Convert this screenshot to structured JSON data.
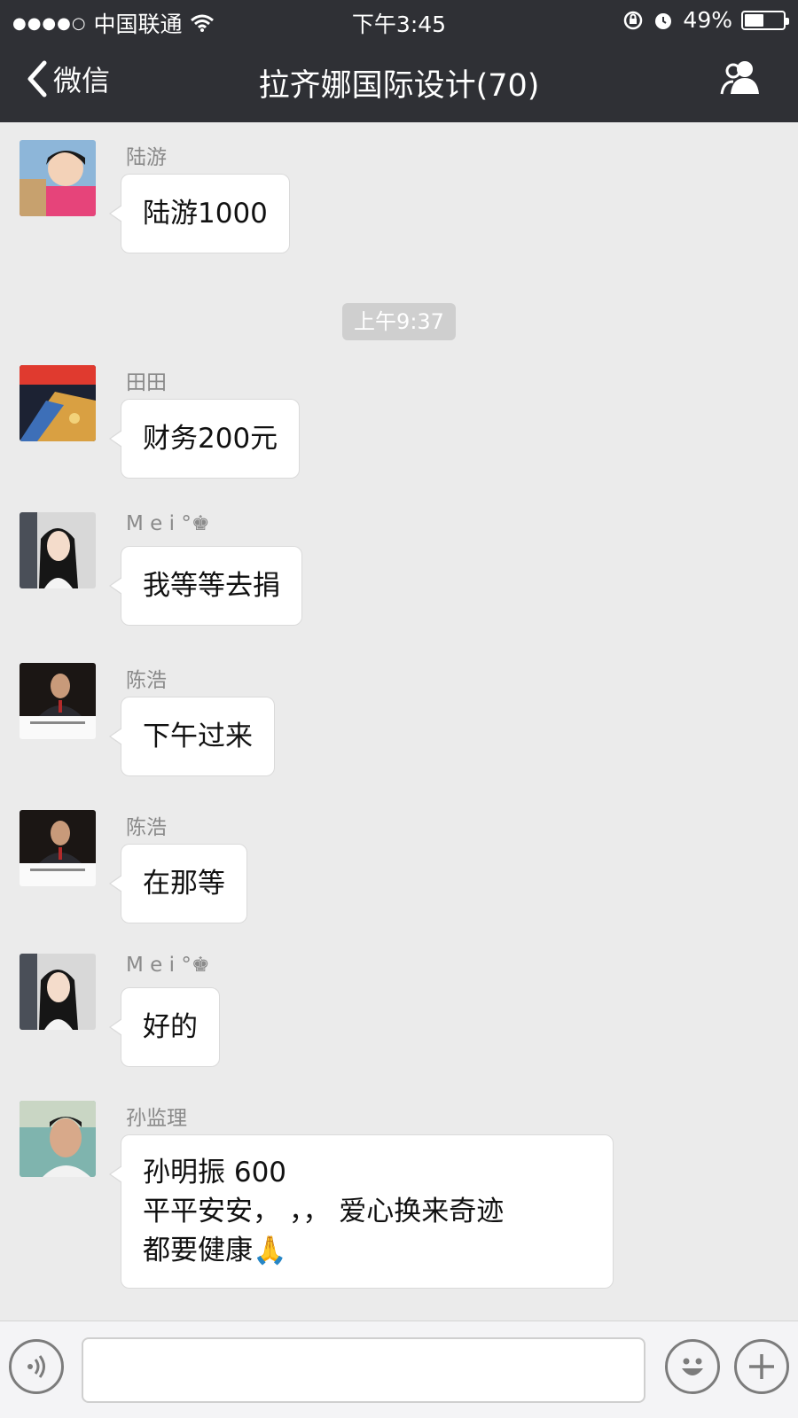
{
  "status_bar": {
    "carrier": "中国联通",
    "time": "下午3:45",
    "battery": "49%",
    "battery_level": 0.49
  },
  "nav": {
    "back_label": "微信",
    "title": "拉齐娜国际设计(70)",
    "group_icon": "group-members-icon"
  },
  "chat": {
    "timestamp": "上午9:37",
    "messages": [
      {
        "sender": "陆游",
        "lines": [
          "陆游1000"
        ]
      },
      {
        "sender": "田田",
        "lines": [
          "财务200元"
        ]
      },
      {
        "sender": "M e i °♚",
        "lines": [
          "我等等去捐"
        ]
      },
      {
        "sender": "陈浩",
        "lines": [
          "下午过来"
        ]
      },
      {
        "sender": "陈浩",
        "lines": [
          "在那等"
        ]
      },
      {
        "sender": "M e i °♚",
        "lines": [
          "好的"
        ]
      },
      {
        "sender": "孙监理",
        "lines": [
          "孙明振    600",
          "平平安安，  ，，  爱心换来奇迹",
          "  都要健康🙏"
        ]
      }
    ]
  },
  "input_bar": {
    "voice_icon": "voice-icon",
    "emoji_icon": "emoji-icon",
    "plus_icon": "plus-icon",
    "placeholder": ""
  },
  "colors": {
    "header_bg": "#2f3035",
    "chat_bg": "#ebebeb",
    "bubble_bg": "#ffffff",
    "timestamp_bg": "#cfcfcf"
  }
}
